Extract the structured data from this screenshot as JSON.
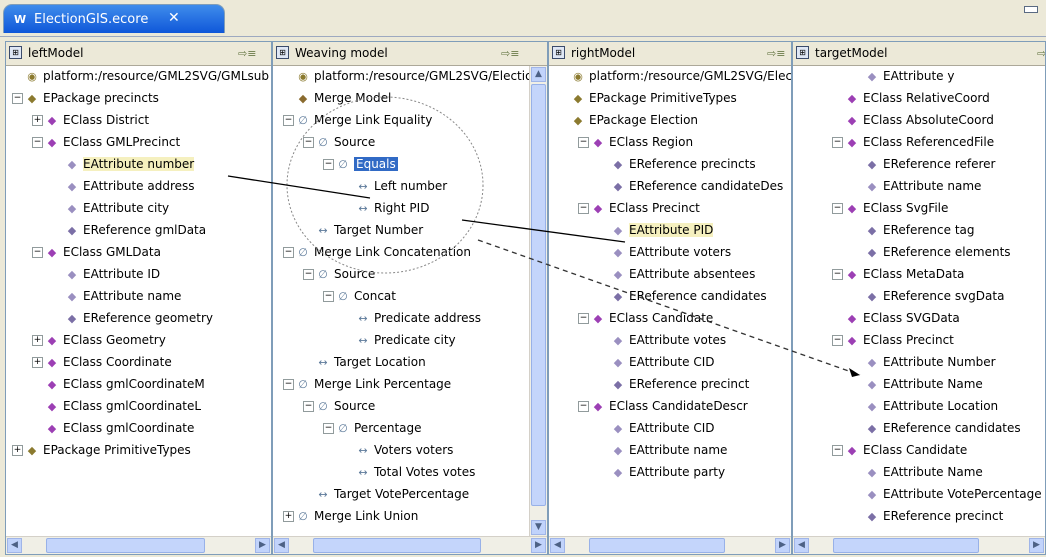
{
  "editor": {
    "tab_icon": "W",
    "tab_title": "ElectionGIS.ecore",
    "close_glyph": "✕"
  },
  "panels": [
    {
      "title": "leftModel",
      "rows": [
        {
          "d": 0,
          "icon": "resource",
          "text": "platform:/resource/GML2SVG/GMLsub"
        },
        {
          "d": 0,
          "icon": "package",
          "exp": "minus",
          "text": "EPackage precincts"
        },
        {
          "d": 1,
          "icon": "class",
          "exp": "plus",
          "text": "EClass District"
        },
        {
          "d": 1,
          "icon": "class",
          "exp": "minus",
          "text": "EClass GMLPrecinct"
        },
        {
          "d": 2,
          "icon": "attribute",
          "text": "EAttribute number",
          "hl": true
        },
        {
          "d": 2,
          "icon": "attribute",
          "text": "EAttribute address"
        },
        {
          "d": 2,
          "icon": "attribute",
          "text": "EAttribute city"
        },
        {
          "d": 2,
          "icon": "reference",
          "text": "EReference gmlData"
        },
        {
          "d": 1,
          "icon": "class",
          "exp": "minus",
          "text": "EClass GMLData"
        },
        {
          "d": 2,
          "icon": "attribute",
          "text": "EAttribute ID"
        },
        {
          "d": 2,
          "icon": "attribute",
          "text": "EAttribute name"
        },
        {
          "d": 2,
          "icon": "reference",
          "text": "EReference geometry"
        },
        {
          "d": 1,
          "icon": "class",
          "exp": "plus",
          "text": "EClass Geometry"
        },
        {
          "d": 1,
          "icon": "class",
          "exp": "plus",
          "text": "EClass Coordinate"
        },
        {
          "d": 1,
          "icon": "class",
          "text": "EClass gmlCoordinateM"
        },
        {
          "d": 1,
          "icon": "class",
          "text": "EClass gmlCoordinateL"
        },
        {
          "d": 1,
          "icon": "class",
          "text": "EClass gmlCoordinate"
        },
        {
          "d": 0,
          "icon": "package",
          "exp": "plus",
          "text": "EPackage PrimitiveTypes"
        }
      ]
    },
    {
      "title": "Weaving model",
      "rows": [
        {
          "d": 0,
          "icon": "resource",
          "text": "platform:/resource/GML2SVG/ElectionG"
        },
        {
          "d": 0,
          "icon": "merge",
          "text": "Merge Model"
        },
        {
          "d": 0,
          "icon": "link",
          "exp": "minus",
          "text": "Merge Link Equality"
        },
        {
          "d": 1,
          "icon": "link",
          "exp": "minus",
          "text": "Source"
        },
        {
          "d": 2,
          "icon": "link",
          "exp": "minus",
          "text": "Equals",
          "sel": true
        },
        {
          "d": 3,
          "icon": "arrow",
          "text": "Left number"
        },
        {
          "d": 3,
          "icon": "arrow",
          "text": "Right PID"
        },
        {
          "d": 1,
          "icon": "arrow",
          "text": "Target Number"
        },
        {
          "d": 0,
          "icon": "link",
          "exp": "minus",
          "text": "Merge Link Concatenation"
        },
        {
          "d": 1,
          "icon": "link",
          "exp": "minus",
          "text": "Source"
        },
        {
          "d": 2,
          "icon": "link",
          "exp": "minus",
          "text": "Concat"
        },
        {
          "d": 3,
          "icon": "arrow",
          "text": "Predicate address"
        },
        {
          "d": 3,
          "icon": "arrow",
          "text": "Predicate city"
        },
        {
          "d": 1,
          "icon": "arrow",
          "text": "Target Location"
        },
        {
          "d": 0,
          "icon": "link",
          "exp": "minus",
          "text": "Merge Link Percentage"
        },
        {
          "d": 1,
          "icon": "link",
          "exp": "minus",
          "text": "Source"
        },
        {
          "d": 2,
          "icon": "link",
          "exp": "minus",
          "text": "Percentage"
        },
        {
          "d": 3,
          "icon": "arrow",
          "text": "Voters voters"
        },
        {
          "d": 3,
          "icon": "arrow",
          "text": "Total Votes votes"
        },
        {
          "d": 1,
          "icon": "arrow",
          "text": "Target VotePercentage"
        },
        {
          "d": 0,
          "icon": "link",
          "exp": "plus",
          "text": "Merge Link Union"
        }
      ]
    },
    {
      "title": "rightModel",
      "rows": [
        {
          "d": 0,
          "icon": "resource",
          "text": "platform:/resource/GML2SVG/Election"
        },
        {
          "d": 0,
          "icon": "package",
          "text": "EPackage PrimitiveTypes"
        },
        {
          "d": 0,
          "icon": "package",
          "text": "EPackage Election"
        },
        {
          "d": 1,
          "icon": "class",
          "exp": "minus",
          "text": "EClass Region"
        },
        {
          "d": 2,
          "icon": "reference",
          "text": "EReference precincts"
        },
        {
          "d": 2,
          "icon": "reference",
          "text": "EReference candidateDes"
        },
        {
          "d": 1,
          "icon": "class",
          "exp": "minus",
          "text": "EClass Precinct"
        },
        {
          "d": 2,
          "icon": "attribute",
          "text": "EAttribute PID",
          "hl": true
        },
        {
          "d": 2,
          "icon": "attribute",
          "text": "EAttribute voters"
        },
        {
          "d": 2,
          "icon": "attribute",
          "text": "EAttribute absentees"
        },
        {
          "d": 2,
          "icon": "reference",
          "text": "EReference candidates"
        },
        {
          "d": 1,
          "icon": "class",
          "exp": "minus",
          "text": "EClass Candidate"
        },
        {
          "d": 2,
          "icon": "attribute",
          "text": "EAttribute votes"
        },
        {
          "d": 2,
          "icon": "attribute",
          "text": "EAttribute CID"
        },
        {
          "d": 2,
          "icon": "reference",
          "text": "EReference precinct"
        },
        {
          "d": 1,
          "icon": "class",
          "exp": "minus",
          "text": "EClass CandidateDescr"
        },
        {
          "d": 2,
          "icon": "attribute",
          "text": "EAttribute CID"
        },
        {
          "d": 2,
          "icon": "attribute",
          "text": "EAttribute name"
        },
        {
          "d": 2,
          "icon": "attribute",
          "text": "EAttribute party"
        }
      ]
    },
    {
      "title": "targetModel",
      "rows": [
        {
          "d": 2,
          "icon": "attribute",
          "text": "EAttribute y"
        },
        {
          "d": 1,
          "icon": "class",
          "text": "EClass RelativeCoord"
        },
        {
          "d": 1,
          "icon": "class",
          "text": "EClass AbsoluteCoord"
        },
        {
          "d": 1,
          "icon": "class",
          "exp": "minus",
          "text": "EClass ReferencedFile"
        },
        {
          "d": 2,
          "icon": "reference",
          "text": "EReference referer"
        },
        {
          "d": 2,
          "icon": "attribute",
          "text": "EAttribute name"
        },
        {
          "d": 1,
          "icon": "class",
          "exp": "minus",
          "text": "EClass SvgFile"
        },
        {
          "d": 2,
          "icon": "reference",
          "text": "EReference tag"
        },
        {
          "d": 2,
          "icon": "reference",
          "text": "EReference elements"
        },
        {
          "d": 1,
          "icon": "class",
          "exp": "minus",
          "text": "EClass MetaData"
        },
        {
          "d": 2,
          "icon": "reference",
          "text": "EReference svgData"
        },
        {
          "d": 1,
          "icon": "class",
          "text": "EClass SVGData"
        },
        {
          "d": 1,
          "icon": "class",
          "exp": "minus",
          "text": "EClass Precinct"
        },
        {
          "d": 2,
          "icon": "attribute",
          "text": "EAttribute Number"
        },
        {
          "d": 2,
          "icon": "attribute",
          "text": "EAttribute Name"
        },
        {
          "d": 2,
          "icon": "attribute",
          "text": "EAttribute Location"
        },
        {
          "d": 2,
          "icon": "reference",
          "text": "EReference candidates"
        },
        {
          "d": 1,
          "icon": "class",
          "exp": "minus",
          "text": "EClass Candidate"
        },
        {
          "d": 2,
          "icon": "attribute",
          "text": "EAttribute Name"
        },
        {
          "d": 2,
          "icon": "attribute",
          "text": "EAttribute VotePercentage"
        },
        {
          "d": 2,
          "icon": "reference",
          "text": "EReference precinct"
        }
      ]
    }
  ]
}
